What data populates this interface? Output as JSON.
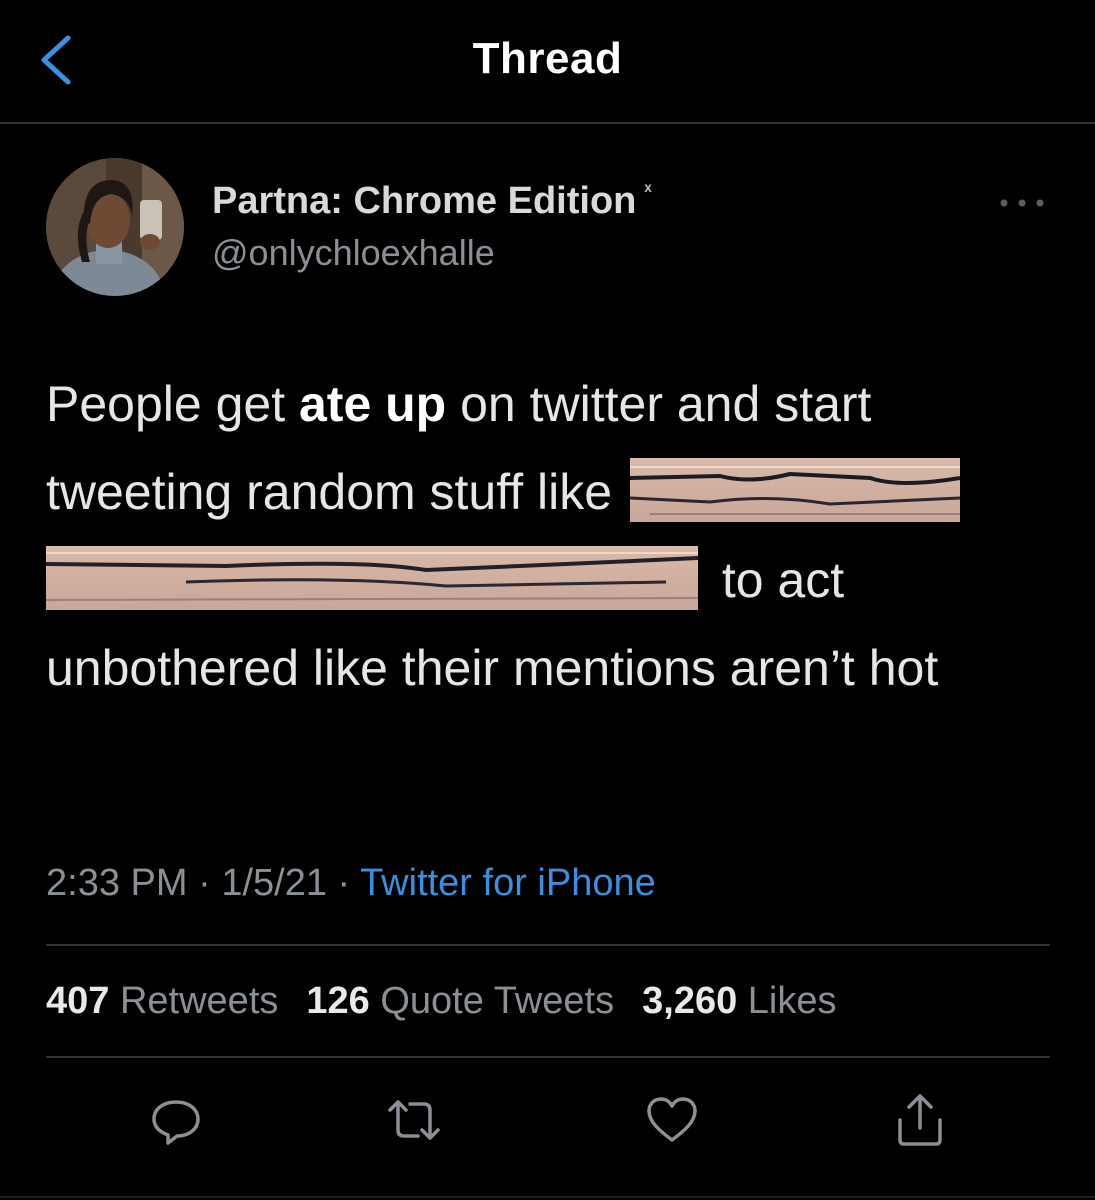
{
  "header": {
    "title": "Thread",
    "back_icon": "chevron-left-icon"
  },
  "tweet": {
    "display_name": "Partna: Chrome Edition",
    "name_suffix": "ˣ",
    "handle": "@onlychloexhalle",
    "more_icon": "more-horizontal-icon",
    "text_parts": {
      "p1": "People get ",
      "bold": "ate up",
      "p2": " on twitter and start tweeting random stuff like ",
      "p3": " to act unbothered like their mentions aren’t hot"
    },
    "time": "2:33 PM",
    "date": "1/5/21",
    "separator": " · ",
    "source": "Twitter for iPhone"
  },
  "stats": {
    "retweets_count": "407",
    "retweets_label": "Retweets",
    "quotes_count": "126",
    "quotes_label": "Quote Tweets",
    "likes_count": "3,260",
    "likes_label": "Likes"
  },
  "actions": [
    "reply-icon",
    "retweet-icon",
    "like-icon",
    "share-icon"
  ],
  "colors": {
    "background": "#000000",
    "text": "#e7e9ea",
    "secondary": "#8b9096",
    "link": "#3a8fe0",
    "divider": "#2f3336"
  }
}
